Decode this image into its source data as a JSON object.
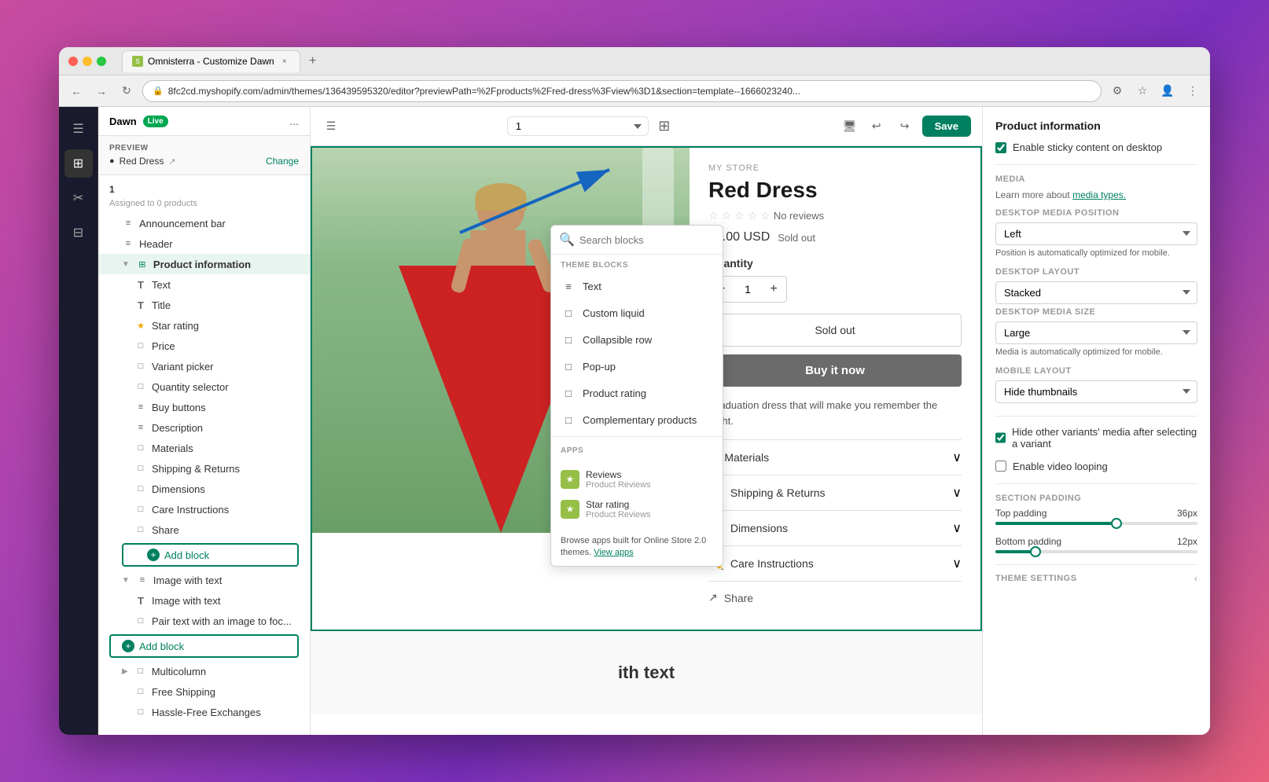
{
  "browser": {
    "tab_title": "Omnisterra - Customize Dawn",
    "url": "8fc2cd.myshopify.com/admin/themes/136439595320/editor?previewPath=%2Fproducts%2Fred-dress%3Fview%3D1&section=template--1666023240...",
    "close_label": "×",
    "new_tab_label": "+"
  },
  "editor_toolbar": {
    "theme_name": "Dawn",
    "live_label": "Live",
    "more_label": "...",
    "preview_num": "1",
    "undo_label": "↩",
    "redo_label": "↪",
    "save_label": "Save"
  },
  "preview": {
    "label": "PREVIEW",
    "product": "Red Dress",
    "change_label": "Change"
  },
  "sidebar_tree": [
    {
      "id": "num-header",
      "label": "1",
      "sub": "Assigned to 0 products",
      "indent": 0,
      "type": "header"
    },
    {
      "id": "announcement-bar",
      "label": "Announcement bar",
      "indent": 1,
      "icon": "≡"
    },
    {
      "id": "header",
      "label": "Header",
      "indent": 1,
      "icon": "≡"
    },
    {
      "id": "product-information",
      "label": "Product information",
      "indent": 1,
      "icon": "active",
      "expanded": true
    },
    {
      "id": "text",
      "label": "Text",
      "indent": 2,
      "icon": "T"
    },
    {
      "id": "title",
      "label": "Title",
      "indent": 2,
      "icon": "T"
    },
    {
      "id": "star-rating",
      "label": "Star rating",
      "indent": 2,
      "icon": "★"
    },
    {
      "id": "price",
      "label": "Price",
      "indent": 2,
      "icon": "□"
    },
    {
      "id": "variant-picker",
      "label": "Variant picker",
      "indent": 2,
      "icon": "□"
    },
    {
      "id": "quantity-selector",
      "label": "Quantity selector",
      "indent": 2,
      "icon": "□"
    },
    {
      "id": "buy-buttons",
      "label": "Buy buttons",
      "indent": 2,
      "icon": "≡"
    },
    {
      "id": "description",
      "label": "Description",
      "indent": 2,
      "icon": "≡"
    },
    {
      "id": "materials",
      "label": "Materials",
      "indent": 2,
      "icon": "□"
    },
    {
      "id": "shipping-returns",
      "label": "Shipping & Returns",
      "indent": 2,
      "icon": "□"
    },
    {
      "id": "dimensions",
      "label": "Dimensions",
      "indent": 2,
      "icon": "□"
    },
    {
      "id": "care-instructions",
      "label": "Care Instructions",
      "indent": 2,
      "icon": "□"
    },
    {
      "id": "share",
      "label": "Share",
      "indent": 2,
      "icon": "□"
    },
    {
      "id": "add-block",
      "label": "Add block",
      "indent": 0,
      "type": "add-block"
    },
    {
      "id": "image-with-text",
      "label": "Image with text",
      "indent": 1,
      "icon": "≡",
      "expanded": true
    },
    {
      "id": "image-with-text-child",
      "label": "Image with text",
      "indent": 2,
      "icon": "T"
    },
    {
      "id": "pair-text",
      "label": "Pair text with an image to foc...",
      "indent": 2,
      "icon": "□"
    },
    {
      "id": "add-block-2",
      "label": "Add block",
      "indent": 0,
      "type": "add-block2"
    },
    {
      "id": "multicolumn",
      "label": "Multicolumn",
      "indent": 1,
      "icon": "□"
    },
    {
      "id": "free-shipping",
      "label": "Free Shipping",
      "indent": 2,
      "icon": "□"
    },
    {
      "id": "hassle-free",
      "label": "Hassle-Free Exchanges",
      "indent": 2,
      "icon": "□"
    }
  ],
  "product": {
    "store_label": "MY STORE",
    "title": "Red Dress",
    "stars": "★★★★★",
    "no_reviews": "No reviews",
    "price": "$0.00 USD",
    "sold_out_inline": "Sold out",
    "quantity_label": "Quantity",
    "quantity_value": "1",
    "sold_out_btn": "Sold out",
    "buy_btn": "Buy it now",
    "description": "Graduation dress that will make you remember the night.",
    "accordions": [
      {
        "id": "materials",
        "icon": "◆",
        "label": "Materials"
      },
      {
        "id": "shipping-returns",
        "icon": "🚚",
        "label": "Shipping & Returns"
      },
      {
        "id": "dimensions",
        "icon": "📐",
        "label": "Dimensions"
      },
      {
        "id": "care-instructions",
        "icon": "✏️",
        "label": "Care Instructions"
      }
    ],
    "share_label": "Share"
  },
  "image_with_text": {
    "title": "ith text"
  },
  "right_panel": {
    "title": "Product information",
    "sticky_label": "Enable sticky content on desktop",
    "media_section": "MEDIA",
    "media_desc_text": "Learn more about",
    "media_types_link": "media types.",
    "desktop_media_pos_label": "Desktop media position",
    "desktop_media_pos_value": "Left",
    "pos_auto_note": "Position is automatically optimized for mobile.",
    "desktop_layout_label": "Desktop layout",
    "desktop_layout_value": "Stacked",
    "desktop_media_size_label": "Desktop media size",
    "desktop_media_size_value": "Large",
    "size_auto_note": "Media is automatically optimized for mobile.",
    "mobile_layout_label": "Mobile layout",
    "mobile_layout_value": "Hide thumbnails",
    "hide_variants_label": "Hide other variants' media after selecting a variant",
    "video_looping_label": "Enable video looping",
    "section_padding_label": "SECTION PADDING",
    "top_padding_label": "Top padding",
    "top_padding_value": "36px",
    "bottom_padding_label": "Bottom padding",
    "bottom_padding_value": "12px",
    "theme_settings_label": "THEME SETTINGS"
  },
  "popup": {
    "search_placeholder": "Search blocks",
    "theme_blocks_label": "THEME BLOCKS",
    "items": [
      {
        "id": "text",
        "label": "Text",
        "icon": "≡"
      },
      {
        "id": "custom-liquid",
        "label": "Custom liquid",
        "icon": "□"
      },
      {
        "id": "collapsible-row",
        "label": "Collapsible row",
        "icon": "□"
      },
      {
        "id": "pop-up",
        "label": "Pop-up",
        "icon": "□"
      },
      {
        "id": "product-rating",
        "label": "Product rating",
        "icon": "□"
      },
      {
        "id": "complementary-products",
        "label": "Complementary products",
        "icon": "□"
      }
    ],
    "apps_label": "APPS",
    "apps": [
      {
        "id": "reviews",
        "label": "Reviews",
        "sub": "Product Reviews"
      },
      {
        "id": "star-rating",
        "label": "Star rating",
        "sub": "Product Reviews"
      }
    ],
    "browse_text": "Browse apps built for Online Store 2.0 themes.",
    "view_apps_link": "View apps"
  }
}
